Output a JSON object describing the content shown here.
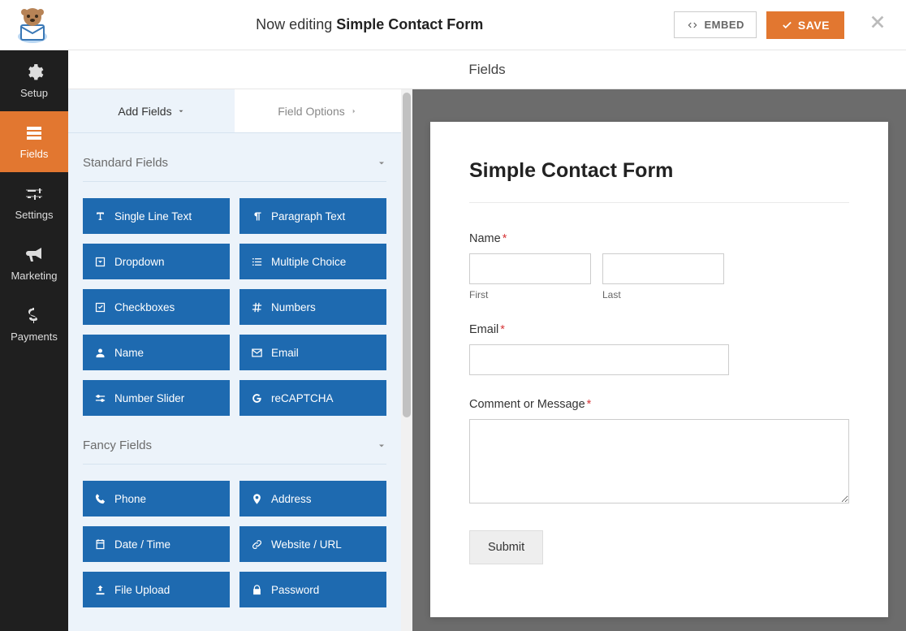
{
  "header": {
    "prefix": "Now editing ",
    "form_name": "Simple Contact Form",
    "embed_label": "EMBED",
    "save_label": "SAVE"
  },
  "sidebar": {
    "items": [
      {
        "label": "Setup",
        "icon": "gear"
      },
      {
        "label": "Fields",
        "icon": "fields"
      },
      {
        "label": "Settings",
        "icon": "sliders"
      },
      {
        "label": "Marketing",
        "icon": "bullhorn"
      },
      {
        "label": "Payments",
        "icon": "dollar"
      }
    ]
  },
  "panel": {
    "heading": "Fields",
    "tabs": {
      "add": "Add Fields",
      "options": "Field Options"
    },
    "sections": [
      {
        "title": "Standard Fields",
        "fields": [
          {
            "label": "Single Line Text",
            "icon": "text"
          },
          {
            "label": "Paragraph Text",
            "icon": "paragraph"
          },
          {
            "label": "Dropdown",
            "icon": "dropdown"
          },
          {
            "label": "Multiple Choice",
            "icon": "list"
          },
          {
            "label": "Checkboxes",
            "icon": "check"
          },
          {
            "label": "Numbers",
            "icon": "hash"
          },
          {
            "label": "Name",
            "icon": "user"
          },
          {
            "label": "Email",
            "icon": "envelope"
          },
          {
            "label": "Number Slider",
            "icon": "slider"
          },
          {
            "label": "reCAPTCHA",
            "icon": "google"
          }
        ]
      },
      {
        "title": "Fancy Fields",
        "fields": [
          {
            "label": "Phone",
            "icon": "phone"
          },
          {
            "label": "Address",
            "icon": "pin"
          },
          {
            "label": "Date / Time",
            "icon": "calendar"
          },
          {
            "label": "Website / URL",
            "icon": "link"
          },
          {
            "label": "File Upload",
            "icon": "upload"
          },
          {
            "label": "Password",
            "icon": "lock"
          }
        ]
      }
    ]
  },
  "form": {
    "title": "Simple Contact Form",
    "name_label": "Name",
    "first_sub": "First",
    "last_sub": "Last",
    "email_label": "Email",
    "comment_label": "Comment or Message",
    "submit_label": "Submit"
  }
}
